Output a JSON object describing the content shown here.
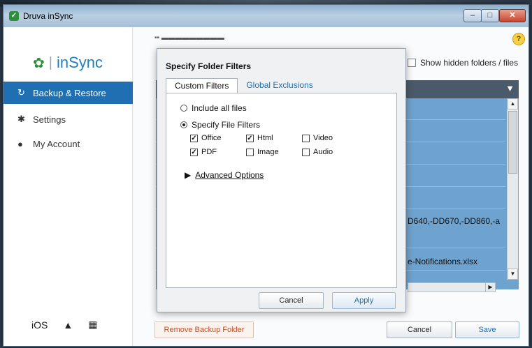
{
  "window": {
    "title": "Druva inSync"
  },
  "sidebar": {
    "logo": "inSync",
    "items": [
      {
        "label": "Backup & Restore",
        "active": true
      },
      {
        "label": "Settings",
        "active": false
      },
      {
        "label": "My Account",
        "active": false
      }
    ],
    "platforms": {
      "ios": "iOS"
    }
  },
  "main": {
    "show_hidden_label": "Show hidden folders / files",
    "help_label": "?",
    "rows": [
      "D640,-DD670,-DD860,-a",
      "e-Notifications.xlsx"
    ],
    "remove_button": "Remove Backup Folder",
    "cancel_button": "Cancel",
    "save_button": "Save"
  },
  "dialog": {
    "title": "Specify Folder Filters",
    "tabs": [
      "Custom Filters",
      "Global Exclusions"
    ],
    "radio_all": "Include all files",
    "radio_specify": "Specify File Filters",
    "filters": [
      {
        "label": "Office",
        "checked": true
      },
      {
        "label": "Html",
        "checked": true
      },
      {
        "label": "Video",
        "checked": false
      },
      {
        "label": "PDF",
        "checked": true
      },
      {
        "label": "Image",
        "checked": false
      },
      {
        "label": "Audio",
        "checked": false
      }
    ],
    "advanced": "Advanced Options",
    "cancel_button": "Cancel",
    "apply_button": "Apply"
  },
  "colors": {
    "accent": "#1f6fb2",
    "brand_green": "#2d8f3b",
    "list_selection": "#6fa3cf",
    "remove_text": "#c0502a"
  }
}
